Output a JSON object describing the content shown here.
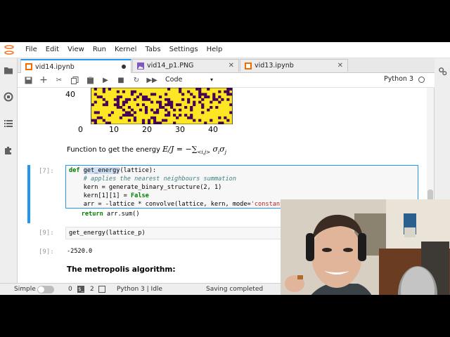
{
  "menubar": {
    "items": [
      "File",
      "Edit",
      "View",
      "Run",
      "Kernel",
      "Tabs",
      "Settings",
      "Help"
    ]
  },
  "tabs": [
    {
      "label": "vid14.ipynb",
      "active": true,
      "icon": "notebook-icon"
    },
    {
      "label": "vid14_p1.PNG",
      "active": false,
      "icon": "image-icon"
    },
    {
      "label": "vid13.ipynb",
      "active": false,
      "icon": "notebook-icon"
    }
  ],
  "toolbar": {
    "cell_type": "Code",
    "kernel": "Python 3"
  },
  "plot": {
    "y_tick": "40",
    "x_ticks": [
      "0",
      "10",
      "20",
      "30",
      "40"
    ],
    "colors": {
      "up": "#fde725",
      "down": "#440154"
    }
  },
  "markdown1": {
    "text": "Function to get the energy ",
    "math": "E/J = −∑",
    "math_sub": "<i,j>",
    "math_tail": " σ",
    "math_i": "i",
    "math_s2": "σ",
    "math_j": "j"
  },
  "cell7": {
    "prompt": "[7]:",
    "lines": [
      {
        "kw": "def ",
        "hl": "get_energy",
        "rest": "(lattice):"
      },
      {
        "cm": "    # applies the nearest neighbours summation"
      },
      {
        "txt": "    kern = generate_binary_structure(2, 1)"
      },
      {
        "txt": "    kern[1][1] = ",
        "kw2": "False"
      },
      {
        "txt": "    arr = -lattice * convolve(lattice, kern, mode=",
        "str": "'constant'"
      },
      {
        "kw": "    return ",
        "txt2": "arr.sum()"
      }
    ]
  },
  "cell9": {
    "prompt": "[9]:",
    "code": "get_energy(lattice_p)",
    "out_prompt": "[9]:",
    "output": "-2520.0"
  },
  "markdown2": {
    "text": "The metropolis algorithm:"
  },
  "statusbar": {
    "mode": "Simple",
    "terminals": "0",
    "kernels": "2",
    "kernel_status": "Python 3 | Idle",
    "save_status": "Saving completed"
  }
}
